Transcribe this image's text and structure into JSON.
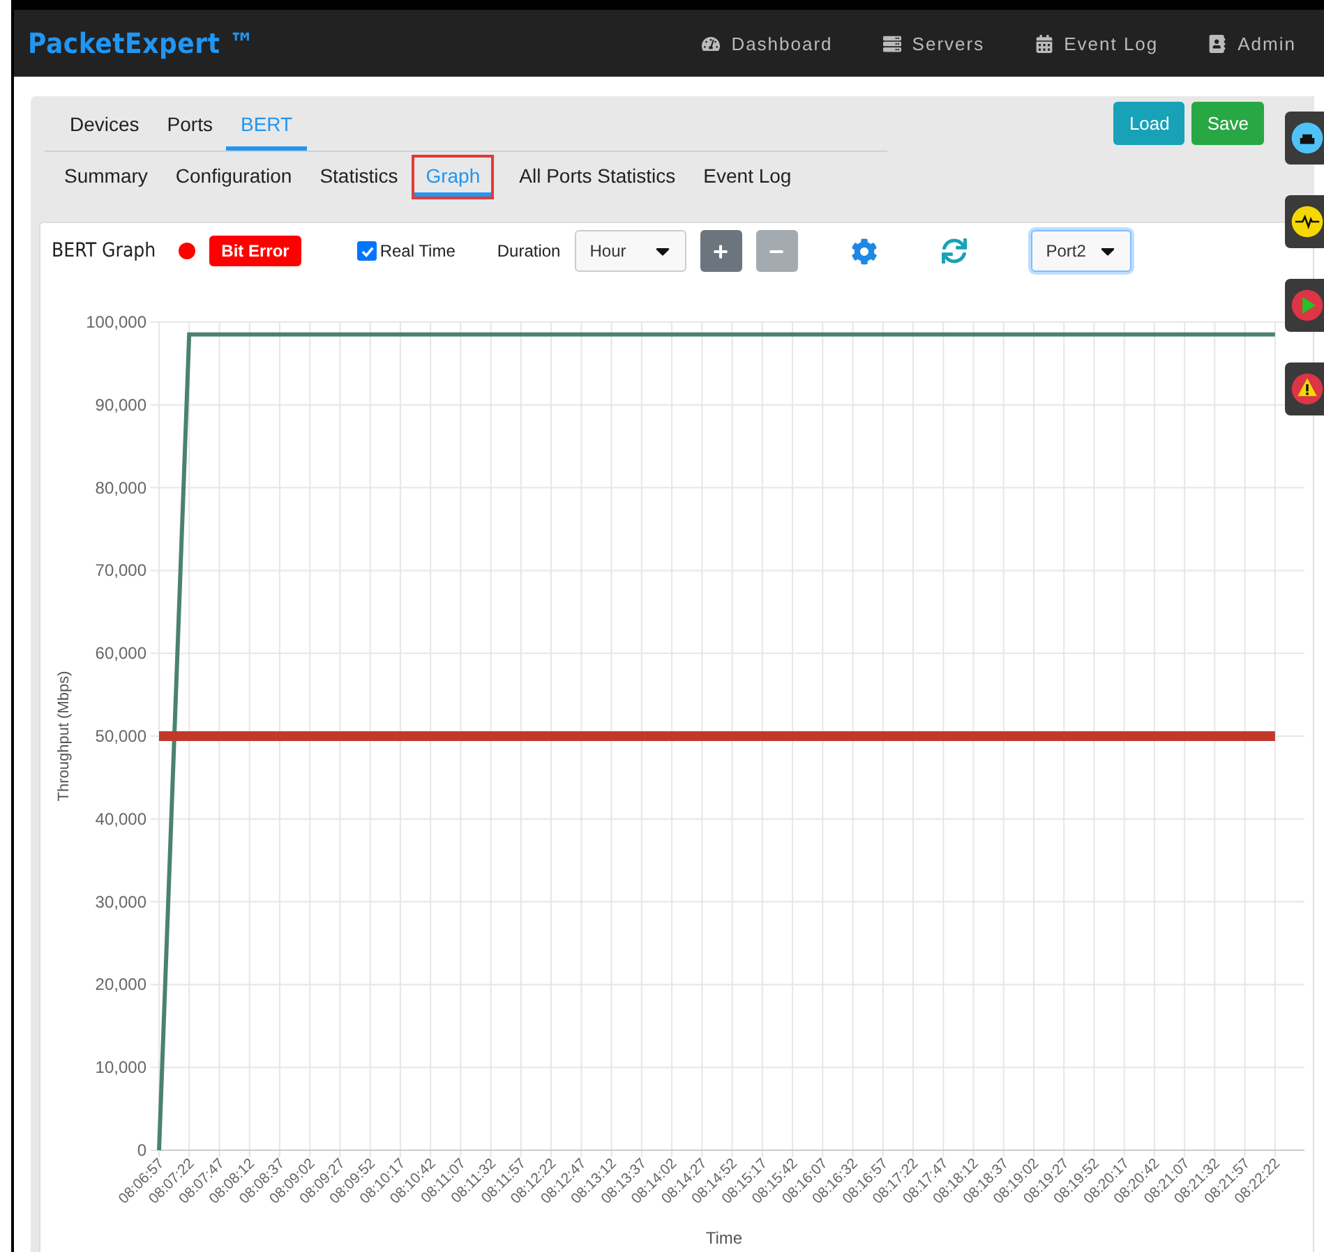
{
  "navbar": {
    "brand": "PacketExpert ™",
    "items": [
      {
        "kind": "dashboard",
        "label": "Dashboard"
      },
      {
        "kind": "servers",
        "label": "Servers"
      },
      {
        "kind": "calendar",
        "label": "Event Log"
      },
      {
        "kind": "admin",
        "label": "Admin"
      }
    ]
  },
  "tabs": [
    {
      "label": "Devices",
      "selected": false
    },
    {
      "label": "Ports",
      "selected": false
    },
    {
      "label": "BERT",
      "selected": true
    }
  ],
  "actions": [
    {
      "kind": "info",
      "label": "Load"
    },
    {
      "kind": "success",
      "label": "Save"
    }
  ],
  "subtabs": [
    {
      "label": "Summary",
      "selected": false
    },
    {
      "label": "Configuration",
      "selected": false
    },
    {
      "label": "Statistics",
      "selected": false
    },
    {
      "label": "Graph",
      "selected": true
    },
    {
      "label": "All Ports Statistics",
      "selected": false
    },
    {
      "label": "Event Log",
      "selected": false
    }
  ],
  "side_buttons": [
    {
      "kind": "network",
      "color": "#4fc3f7"
    },
    {
      "kind": "pulse",
      "color": "#f5d800"
    },
    {
      "kind": "play",
      "color": "#dc3545"
    },
    {
      "kind": "warning",
      "color": "#dc3545"
    }
  ],
  "graph_panel": {
    "title": "BERT Graph",
    "status_dot": {
      "color": "#ff0000"
    },
    "status_badge": "Bit Error",
    "real_time": {
      "label": "Real Time",
      "checked": true
    },
    "duration": {
      "label": "Duration",
      "value": "Hour"
    },
    "port": {
      "value": "Port2"
    },
    "chart_data": {
      "type": "line",
      "xlabel": "Time",
      "ylabel": "Throughput (Mbps)",
      "categories": [
        "08:06:57",
        "08:07:22",
        "08:07:47",
        "08:08:12",
        "08:08:37",
        "08:09:02",
        "08:09:27",
        "08:09:52",
        "08:10:17",
        "08:10:42",
        "08:11:07",
        "08:11:32",
        "08:11:57",
        "08:12:22",
        "08:12:47",
        "08:13:12",
        "08:13:37",
        "08:14:02",
        "08:14:27",
        "08:14:52",
        "08:15:17",
        "08:15:42",
        "08:16:07",
        "08:16:32",
        "08:16:57",
        "08:17:22",
        "08:17:47",
        "08:18:12",
        "08:18:37",
        "08:19:02",
        "08:19:27",
        "08:19:52",
        "08:20:17",
        "08:20:42",
        "08:21:07",
        "08:21:32",
        "08:21:57",
        "08:22:22"
      ],
      "ylim": [
        0,
        100000
      ],
      "grid": true,
      "yticks": [
        {
          "value": 0,
          "label": "0"
        },
        {
          "value": 10000,
          "label": "10,000"
        },
        {
          "value": 20000,
          "label": "20,000"
        },
        {
          "value": 30000,
          "label": "30,000"
        },
        {
          "value": 40000,
          "label": "40,000"
        },
        {
          "value": 50000,
          "label": "50,000"
        },
        {
          "value": 60000,
          "label": "60,000"
        },
        {
          "value": 70000,
          "label": "70,000"
        },
        {
          "value": 80000,
          "label": "80,000"
        },
        {
          "value": 90000,
          "label": "90,000"
        },
        {
          "value": 100000,
          "label": "100,000"
        }
      ],
      "series": [
        {
          "color": "#4a8272",
          "values": [
            0,
            98500,
            98500,
            98500,
            98500,
            98500,
            98500,
            98500,
            98500,
            98500,
            98500,
            98500,
            98500,
            98500,
            98500,
            98500,
            98500,
            98500,
            98500,
            98500,
            98500,
            98500,
            98500,
            98500,
            98500,
            98500,
            98500,
            98500,
            98500,
            98500,
            98500,
            98500,
            98500,
            98500,
            98500,
            98500,
            98500,
            98500
          ]
        },
        {
          "color": "#c0392b",
          "values": [
            50000,
            50000,
            50000,
            50000,
            50000,
            50000,
            50000,
            50000,
            50000,
            50000,
            50000,
            50000,
            50000,
            50000,
            50000,
            50000,
            50000,
            50000,
            50000,
            50000,
            50000,
            50000,
            50000,
            50000,
            50000,
            50000,
            50000,
            50000,
            50000,
            50000,
            50000,
            50000,
            50000,
            50000,
            50000,
            50000,
            50000,
            50000
          ]
        }
      ]
    }
  }
}
